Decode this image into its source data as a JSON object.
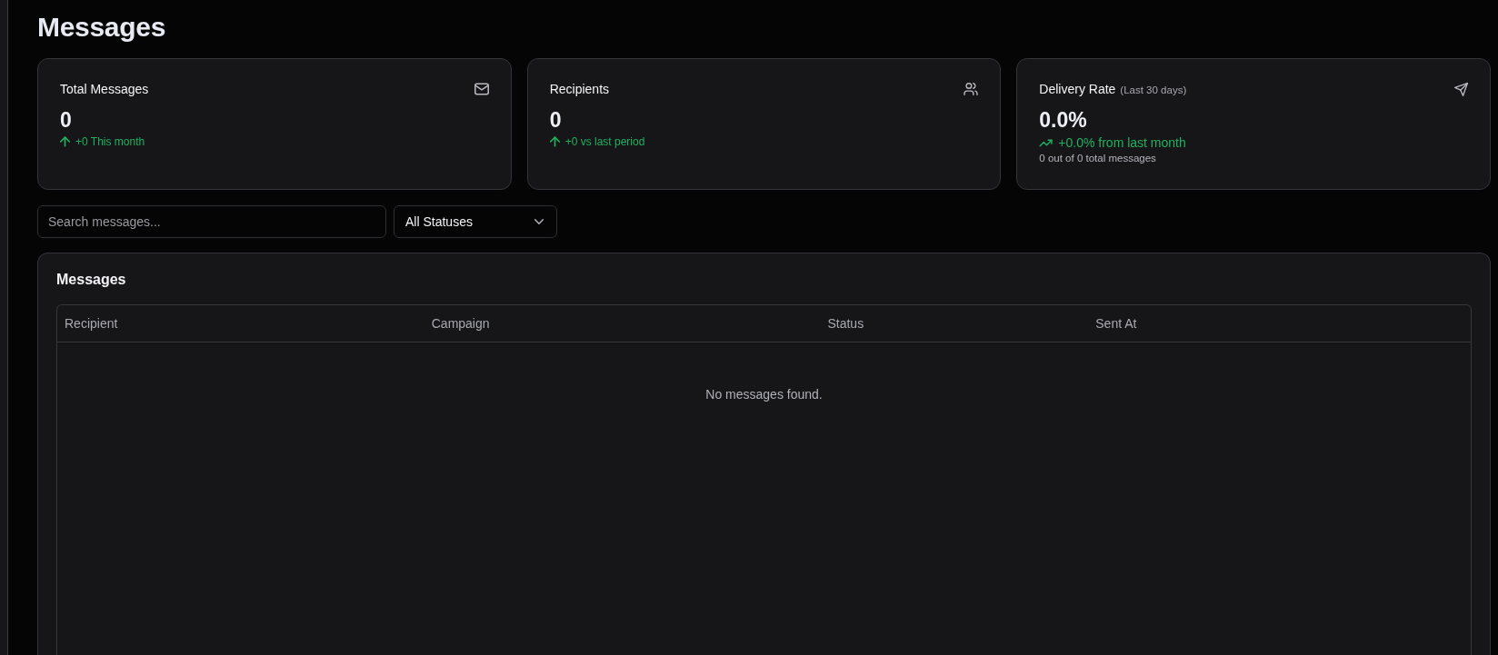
{
  "page": {
    "title": "Messages"
  },
  "stats": [
    {
      "kind": "count",
      "title": "Total Messages",
      "value": "0",
      "trend": "+0 This month"
    },
    {
      "kind": "people",
      "title": "Recipients",
      "value": "0",
      "trend": "+0 vs last period"
    },
    {
      "kind": "rate",
      "title": "Delivery Rate",
      "period": "(Last 30 days)",
      "value": "0.0%",
      "trend": "+0.0% from last month",
      "note": "0 out of 0 total messages"
    }
  ],
  "filters": {
    "search": {
      "placeholder": "Search messages..."
    },
    "status": {
      "value": "All Statuses"
    }
  },
  "table": {
    "title": "Messages",
    "columns": [
      "Recipient",
      "Campaign",
      "Status",
      "Sent At"
    ],
    "empty_text": "No messages found."
  }
}
